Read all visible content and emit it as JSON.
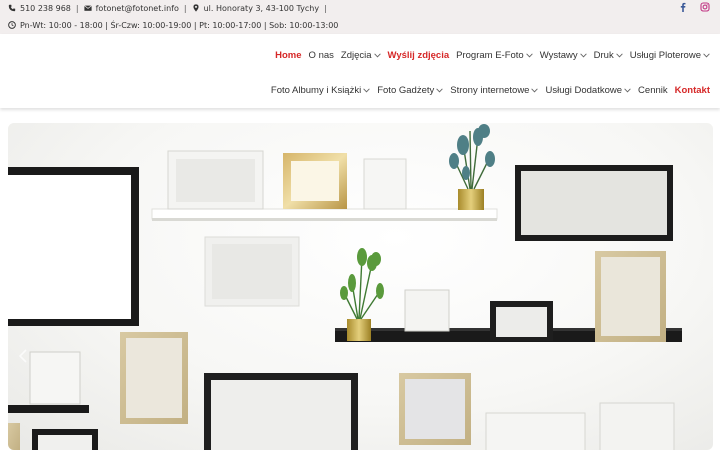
{
  "topbar": {
    "phone": "510 238 968",
    "email": "fotonet@fotonet.info",
    "address": "ul. Honoraty 3, 43-100 Tychy",
    "hours": "Pn-Wt: 10:00 - 18:00 | Śr-Czw: 10:00-19:00 | Pt: 10:00-17:00 | Sob: 10:00-13:00",
    "separator": "|",
    "icons": [
      "phone-icon",
      "envelope-icon",
      "map-marker-icon",
      "clock-icon"
    ],
    "social": [
      "facebook-icon",
      "instagram-icon"
    ]
  },
  "nav": {
    "row1": [
      {
        "label": "Home",
        "dropdown": false,
        "accent": true
      },
      {
        "label": "O nas",
        "dropdown": false,
        "accent": false
      },
      {
        "label": "Zdjęcia",
        "dropdown": true,
        "accent": false
      },
      {
        "label": "Wyślij zdjęcia",
        "dropdown": false,
        "accent": true
      },
      {
        "label": "Program E-Foto",
        "dropdown": true,
        "accent": false
      },
      {
        "label": "Wystawy",
        "dropdown": true,
        "accent": false
      },
      {
        "label": "Druk",
        "dropdown": true,
        "accent": false
      },
      {
        "label": "Usługi Ploterowe",
        "dropdown": true,
        "accent": false
      }
    ],
    "row2": [
      {
        "label": "Foto Albumy i Książki",
        "dropdown": true,
        "accent": false
      },
      {
        "label": "Foto Gadżety",
        "dropdown": true,
        "accent": false
      },
      {
        "label": "Strony internetowe",
        "dropdown": true,
        "accent": false
      },
      {
        "label": "Usługi Dodatkowe",
        "dropdown": true,
        "accent": false
      },
      {
        "label": "Cennik",
        "dropdown": false,
        "accent": false
      },
      {
        "label": "Kontakt",
        "dropdown": false,
        "accent": true
      }
    ]
  },
  "colors": {
    "accent": "#d62828",
    "topbar_bg": "#f2eeee",
    "facebook": "#3b5998",
    "instagram": "#c13584"
  },
  "hero": {
    "image": "picture-frames-on-wall",
    "prev_icon": "chevron-left-icon"
  }
}
